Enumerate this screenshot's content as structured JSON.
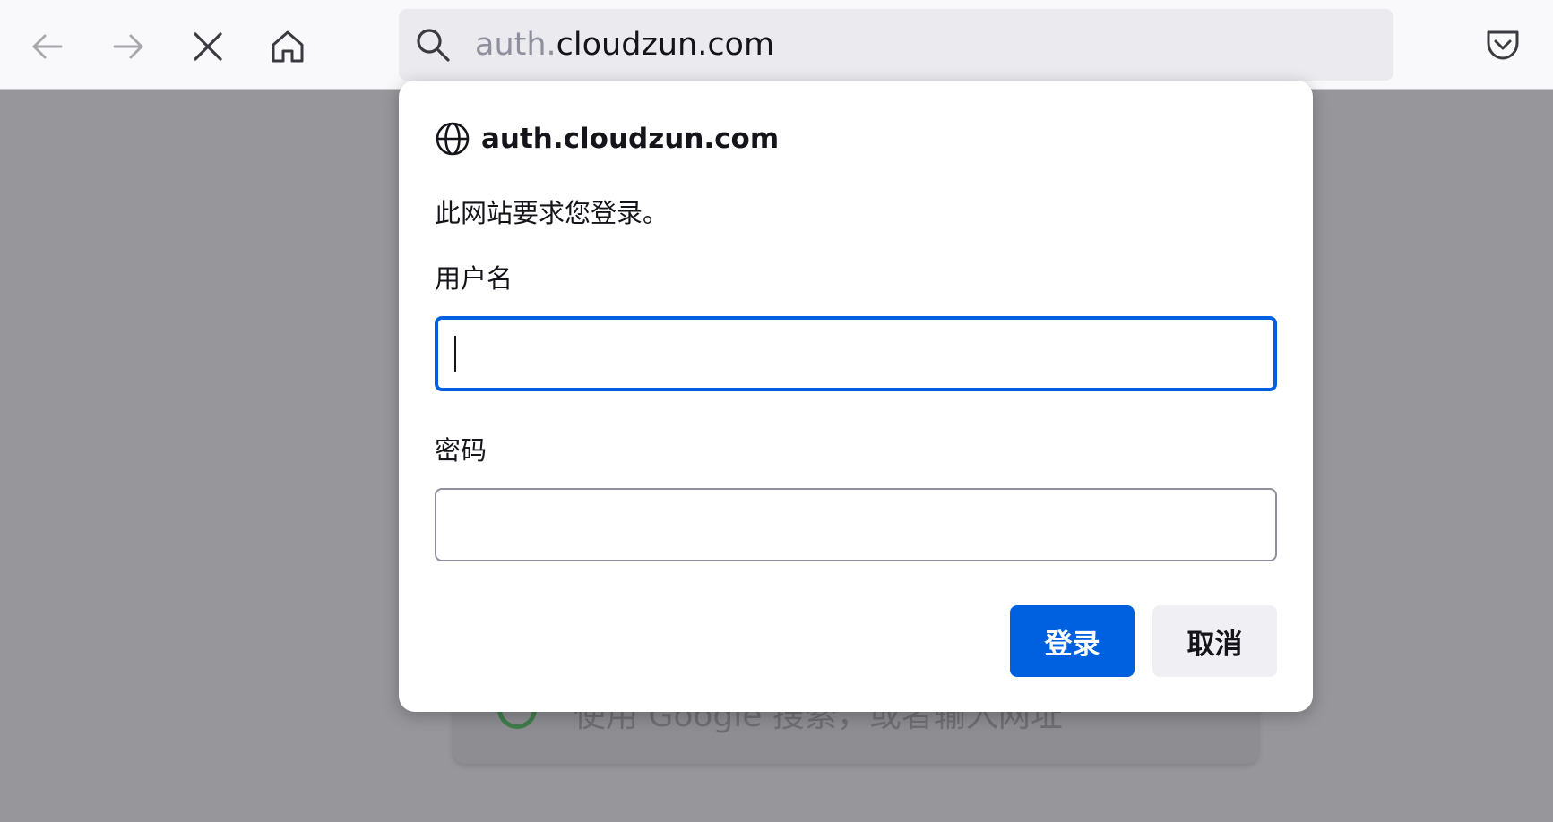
{
  "toolbar": {
    "back_icon": "back-arrow-icon",
    "forward_icon": "forward-arrow-icon",
    "stop_icon": "close-icon",
    "home_icon": "home-icon",
    "url_prefix": "auth.",
    "url_domain": "cloudzun.com",
    "pocket_icon": "pocket-icon"
  },
  "background": {
    "search_hint": "使用 Google 搜索，或者输入网址"
  },
  "dialog": {
    "site": "auth.cloudzun.com",
    "site_icon": "globe-icon",
    "message": "此网站要求您登录。",
    "username_label": "用户名",
    "username_value": "",
    "password_label": "密码",
    "password_value": "",
    "login_button": "登录",
    "cancel_button": "取消"
  },
  "colors": {
    "accent": "#0061e0",
    "focus_border": "#0060df",
    "overlay": "#97969b"
  }
}
